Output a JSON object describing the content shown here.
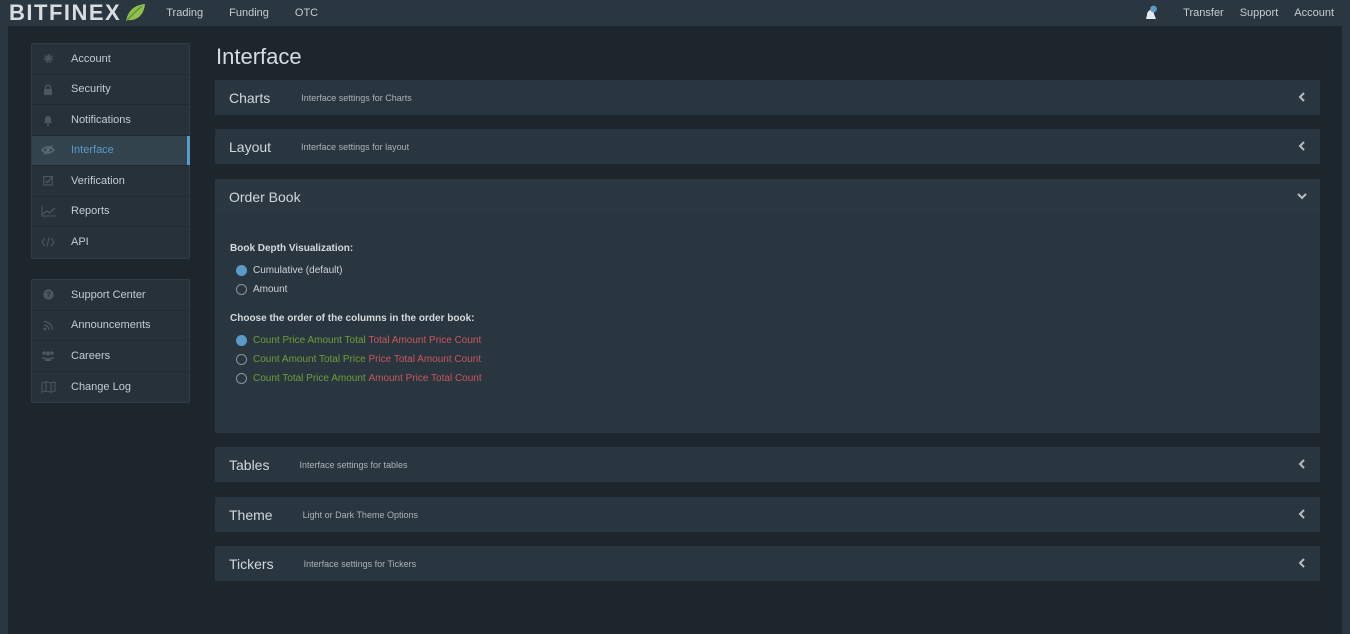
{
  "topnav": {
    "brand": "BITFINEX",
    "left_links": [
      "Trading",
      "Funding",
      "OTC"
    ],
    "right_links": [
      "Transfer",
      "Support",
      "Account"
    ],
    "notification_icon": "bell-icon",
    "brand_color": "#97c554",
    "accent": "#5b9ac9"
  },
  "sidebar": {
    "primary": [
      {
        "label": "Account",
        "icon": "gear-icon",
        "active": false
      },
      {
        "label": "Security",
        "icon": "lock-icon",
        "active": false
      },
      {
        "label": "Notifications",
        "icon": "bell-icon",
        "active": false
      },
      {
        "label": "Interface",
        "icon": "eye-slash-icon",
        "active": true
      },
      {
        "label": "Verification",
        "icon": "checkbox-icon",
        "active": false
      },
      {
        "label": "Reports",
        "icon": "chart-line-icon",
        "active": false
      },
      {
        "label": "API",
        "icon": "code-icon",
        "active": false
      }
    ],
    "secondary": [
      {
        "label": "Support Center",
        "icon": "question-circle-icon"
      },
      {
        "label": "Announcements",
        "icon": "rss-icon"
      },
      {
        "label": "Careers",
        "icon": "users-icon"
      },
      {
        "label": "Change Log",
        "icon": "map-icon"
      }
    ]
  },
  "main": {
    "title": "Interface",
    "panels": [
      {
        "title": "Charts",
        "subtitle": "Interface settings for Charts",
        "expanded": false
      },
      {
        "title": "Layout",
        "subtitle": "Interface settings for layout",
        "expanded": false
      },
      {
        "title": "Order Book",
        "subtitle": "",
        "expanded": true
      },
      {
        "title": "Tables",
        "subtitle": "Interface settings for tables",
        "expanded": false
      },
      {
        "title": "Theme",
        "subtitle": "Light or Dark Theme Options",
        "expanded": false
      },
      {
        "title": "Tickers",
        "subtitle": "Interface settings for Tickers",
        "expanded": false
      }
    ],
    "order_book": {
      "depth_label": "Book Depth Visualization:",
      "depth_options": [
        {
          "label": "Cumulative (default)",
          "checked": true
        },
        {
          "label": "Amount",
          "checked": false
        }
      ],
      "columns_label": "Choose the order of the columns in the order book:",
      "column_options": [
        {
          "bid": "Count Price Amount Total",
          "ask": "Total Amount Price Count",
          "checked": true
        },
        {
          "bid": "Count Amount Total Price",
          "ask": "Price Total Amount Count",
          "checked": false
        },
        {
          "bid": "Count Total Price Amount",
          "ask": "Amount Price Total Count",
          "checked": false
        }
      ],
      "bid_color": "#6f9d3a",
      "ask_color": "#c9565c"
    }
  }
}
